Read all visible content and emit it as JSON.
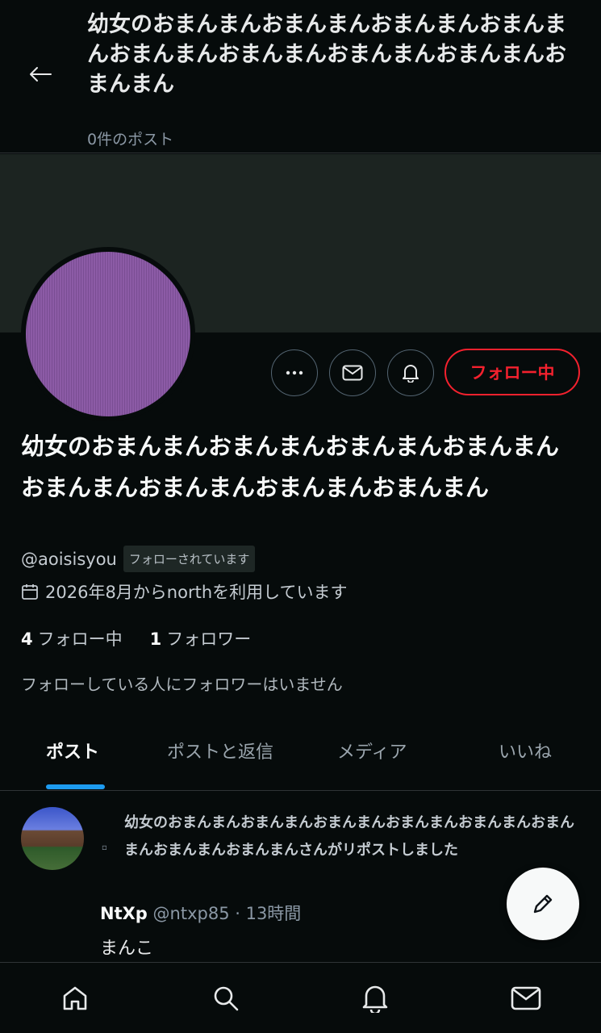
{
  "header": {
    "title": "幼女のおまんまんおまんまんおまんまんおまんまんおまんまんおまんまんおまんまんおまんまんおまんまん",
    "post_count": "0件のポスト"
  },
  "profile": {
    "name": "幼女のおまんまんおまんまんおまんまんおまんまんおまんまんおまんまんおまんまんおまんまん",
    "handle": "@aoisisyou",
    "follows_you_badge": "フォローされています",
    "joined": "2026年8月からnorthを利用しています",
    "following_count": "4",
    "following_label": "フォロー中",
    "followers_count": "1",
    "followers_label": "フォロワー",
    "no_common_followers": "フォローしている人にフォロワーはいません",
    "follow_button": "フォロー中",
    "avatar_color": "#8c5ba6"
  },
  "actions": {
    "more_glyph": "···",
    "accent_color": "#f4212e"
  },
  "tabs": [
    {
      "label": "ポスト",
      "active": true
    },
    {
      "label": "ポストと返信",
      "active": false
    },
    {
      "label": "メディア",
      "active": false
    },
    {
      "label": "いいね",
      "active": false
    }
  ],
  "post": {
    "repost_text": "幼女のおまんまんおまんまんおまんまんおまんまんおまんまんおまんまんおまんまんおまんまんさんがリポストしました",
    "author_name": "NtXp",
    "author_handle_time": "@ntxp85 · 13時間",
    "body": "まんこ"
  },
  "nav": [
    "home-icon",
    "search-icon",
    "bell-icon",
    "mail-icon"
  ]
}
